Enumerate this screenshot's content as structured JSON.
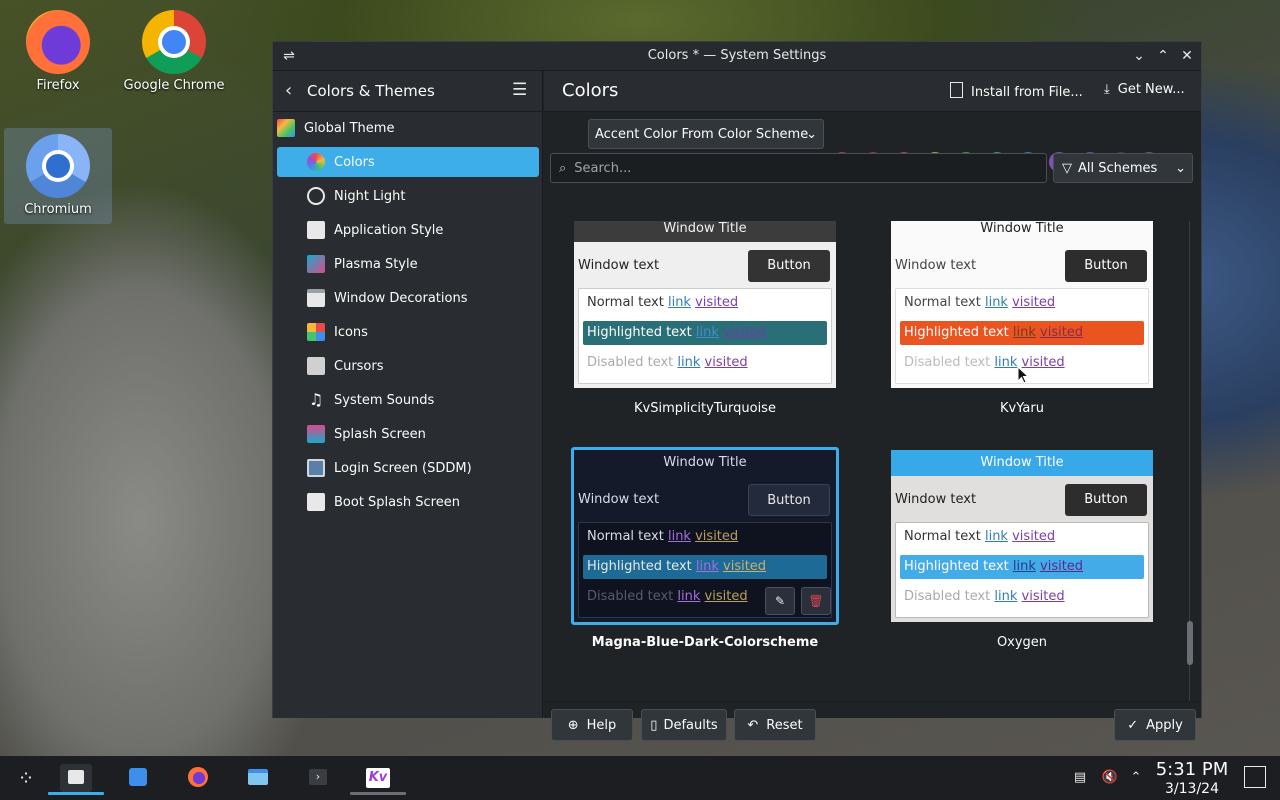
{
  "desktop": {
    "icons": [
      {
        "label": "Firefox"
      },
      {
        "label": "Google Chrome"
      },
      {
        "label": "Chromium"
      }
    ]
  },
  "window": {
    "title": "Colors * — System Settings",
    "sidebar": {
      "header": "Colors & Themes",
      "items": [
        {
          "label": "Global Theme"
        },
        {
          "label": "Colors"
        },
        {
          "label": "Night Light"
        },
        {
          "label": "Application Style"
        },
        {
          "label": "Plasma Style"
        },
        {
          "label": "Window Decorations"
        },
        {
          "label": "Icons"
        },
        {
          "label": "Cursors"
        },
        {
          "label": "System Sounds"
        },
        {
          "label": "Splash Screen"
        },
        {
          "label": "Login Screen (SDDM)"
        },
        {
          "label": "Boot Splash Screen"
        }
      ]
    },
    "main": {
      "title": "Colors",
      "install_label": "Install from File...",
      "get_new_label": "Get New...",
      "accent_select": "Accent Color From Color Scheme",
      "accent_colors": [
        "#b0376a",
        "#a83445",
        "#a6533a",
        "#b2a03c",
        "#3f9e3d",
        "#2e9c8c",
        "#2f7db5",
        "#8052b5",
        "#6b4fb5",
        "#40444a"
      ],
      "search_placeholder": "Search...",
      "filter_label": "All Schemes",
      "preview_texts": {
        "window_title": "Window Title",
        "window_text": "Window text",
        "button": "Button",
        "normal_text": "Normal text",
        "highlighted_text": "Highlighted text",
        "disabled_text": "Disabled text",
        "link": "link",
        "visited": "visited"
      },
      "schemes": [
        {
          "name": "KvSimplicityTurquoise"
        },
        {
          "name": "KvYaru"
        },
        {
          "name": "Magna-Blue-Dark-Colorscheme"
        },
        {
          "name": "Oxygen"
        }
      ],
      "footer": {
        "help": "Help",
        "defaults": "Defaults",
        "reset": "Reset",
        "apply": "Apply"
      }
    }
  },
  "taskbar": {
    "time": "5:31 PM",
    "date": "3/13/24"
  }
}
